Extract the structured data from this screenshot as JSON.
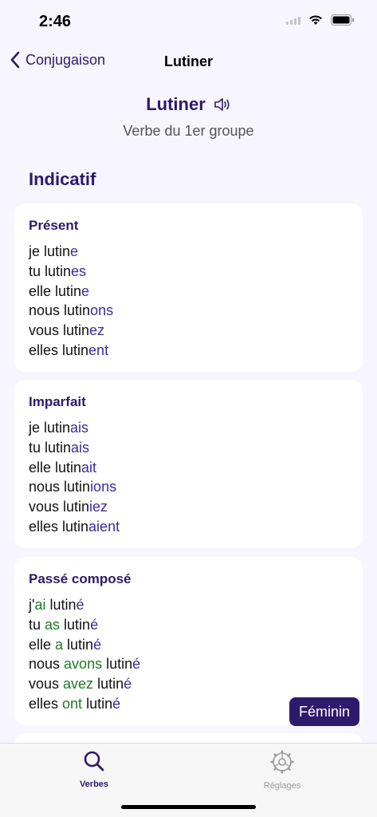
{
  "status": {
    "time": "2:46"
  },
  "nav": {
    "back_label": "Conjugaison",
    "title": "Lutiner"
  },
  "verb": {
    "name": "Lutiner",
    "group": "Verbe du 1er groupe"
  },
  "mood": "Indicatif",
  "tenses": [
    {
      "name": "Présent",
      "rows": [
        {
          "parts": [
            [
              "je lutin",
              ""
            ],
            [
              "e",
              "end"
            ]
          ]
        },
        {
          "parts": [
            [
              "tu lutin",
              ""
            ],
            [
              "es",
              "end"
            ]
          ]
        },
        {
          "parts": [
            [
              "elle lutin",
              ""
            ],
            [
              "e",
              "end"
            ]
          ]
        },
        {
          "parts": [
            [
              "nous lutin",
              ""
            ],
            [
              "ons",
              "end"
            ]
          ]
        },
        {
          "parts": [
            [
              "vous lutin",
              ""
            ],
            [
              "ez",
              "end"
            ]
          ]
        },
        {
          "parts": [
            [
              "elles lutin",
              ""
            ],
            [
              "ent",
              "end"
            ]
          ]
        }
      ]
    },
    {
      "name": "Imparfait",
      "rows": [
        {
          "parts": [
            [
              "je lutin",
              ""
            ],
            [
              "ais",
              "end"
            ]
          ]
        },
        {
          "parts": [
            [
              "tu lutin",
              ""
            ],
            [
              "ais",
              "end"
            ]
          ]
        },
        {
          "parts": [
            [
              "elle lutin",
              ""
            ],
            [
              "ait",
              "end"
            ]
          ]
        },
        {
          "parts": [
            [
              "nous lutin",
              ""
            ],
            [
              "ions",
              "end"
            ]
          ]
        },
        {
          "parts": [
            [
              "vous lutin",
              ""
            ],
            [
              "iez",
              "end"
            ]
          ]
        },
        {
          "parts": [
            [
              "elles lutin",
              ""
            ],
            [
              "aient",
              "end"
            ]
          ]
        }
      ]
    },
    {
      "name": "Passé composé",
      "rows": [
        {
          "parts": [
            [
              "j'",
              ""
            ],
            [
              "ai",
              "aux"
            ],
            [
              " lutin",
              ""
            ],
            [
              "é",
              "end"
            ]
          ]
        },
        {
          "parts": [
            [
              "tu ",
              ""
            ],
            [
              "as",
              "aux"
            ],
            [
              " lutin",
              ""
            ],
            [
              "é",
              "end"
            ]
          ]
        },
        {
          "parts": [
            [
              "elle ",
              ""
            ],
            [
              "a",
              "aux"
            ],
            [
              " lutin",
              ""
            ],
            [
              "é",
              "end"
            ]
          ]
        },
        {
          "parts": [
            [
              "nous ",
              ""
            ],
            [
              "avons",
              "aux"
            ],
            [
              " lutin",
              ""
            ],
            [
              "é",
              "end"
            ]
          ]
        },
        {
          "parts": [
            [
              "vous ",
              ""
            ],
            [
              "avez",
              "aux"
            ],
            [
              " lutin",
              ""
            ],
            [
              "é",
              "end"
            ]
          ]
        },
        {
          "parts": [
            [
              "elles ",
              ""
            ],
            [
              "ont",
              "aux"
            ],
            [
              " lutin",
              ""
            ],
            [
              "é",
              "end"
            ]
          ]
        }
      ]
    }
  ],
  "feminin_label": "Féminin",
  "tabs": [
    {
      "label": "Verbes",
      "icon": "search-icon",
      "active": true
    },
    {
      "label": "Réglages",
      "icon": "gear-icon",
      "active": false
    }
  ],
  "colors": {
    "accent": "#2e1a6b",
    "ending": "#3e2a9e",
    "auxiliary": "#1e7a28",
    "background": "#f7f5fd"
  }
}
